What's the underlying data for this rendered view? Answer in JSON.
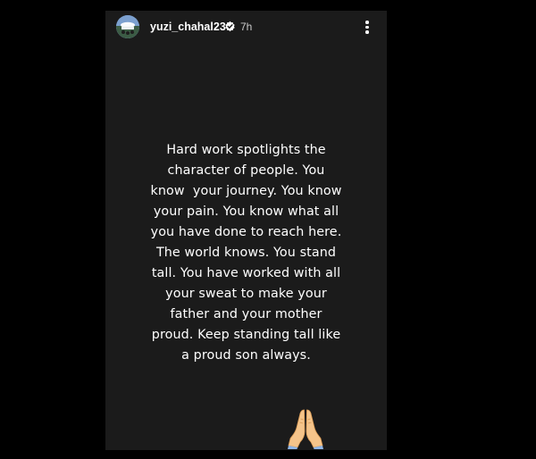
{
  "story": {
    "username": "yuzi_chahal23",
    "time": "7h",
    "message_lines": [
      "Hard work spotlights the",
      "character of people. You",
      "know  your journey. You know",
      "your pain. You know what all",
      "you have done to reach here.",
      "The world knows. You stand",
      "tall. You have worked with all",
      "your sweat to make your",
      "father and your mother",
      "proud. Keep standing tall like",
      "a proud son always."
    ],
    "emoji": "folded-hands-emoji"
  },
  "icons": {
    "avatar": "profile-avatar",
    "verified": "verified-badge-icon",
    "menu": "more-options-icon"
  },
  "colors": {
    "page_background": "#000000",
    "story_background": "#1b1b1b",
    "text": "#ffffff",
    "secondary_text": "#c8c8c8",
    "skin_tone": "#f5c48a"
  }
}
